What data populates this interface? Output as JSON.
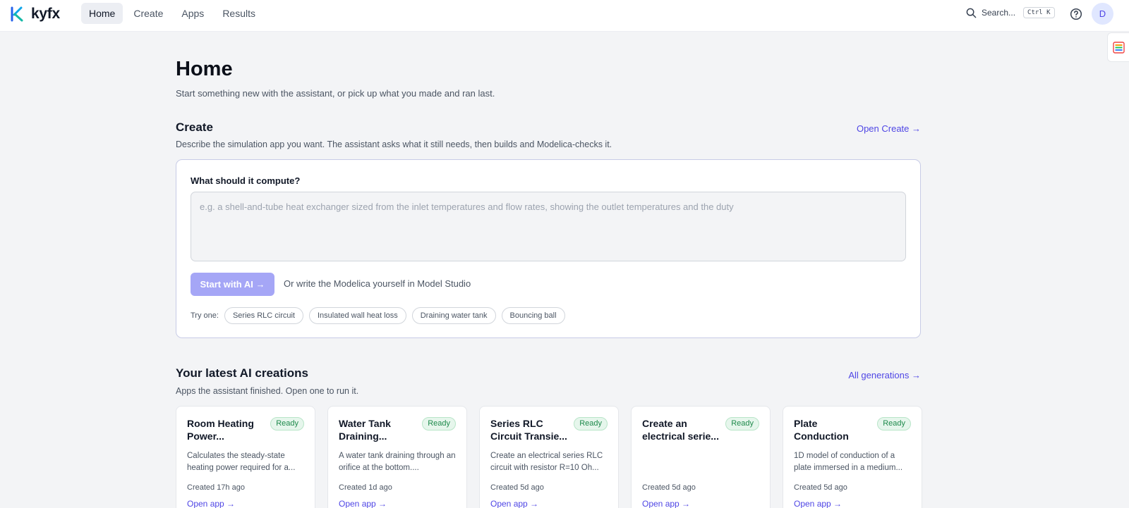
{
  "brand": {
    "name": "kyfx",
    "accent": "#4f46e5"
  },
  "nav": {
    "items": [
      {
        "label": "Home",
        "active": true
      },
      {
        "label": "Create",
        "active": false
      },
      {
        "label": "Apps",
        "active": false
      },
      {
        "label": "Results",
        "active": false
      }
    ]
  },
  "header": {
    "search_label": "Search...",
    "shortcut": "Ctrl K",
    "avatar_initial": "D"
  },
  "page": {
    "title": "Home",
    "subtitle": "Start something new with the assistant, or pick up what you made and ran last."
  },
  "create": {
    "title": "Create",
    "link": "Open Create →",
    "description": "Describe the simulation app you want. The assistant asks what it still needs, then builds and Modelica-checks it.",
    "question": "What should it compute?",
    "placeholder": "e.g. a shell-and-tube heat exchanger sized from the inlet temperatures and flow rates, showing the outlet temperatures and the duty",
    "start_button": "Start with AI →",
    "alt_link": "Or write the Modelica yourself in Model Studio",
    "try_label": "Try one:",
    "examples": [
      "Series RLC circuit",
      "Insulated wall heat loss",
      "Draining water tank",
      "Bouncing ball"
    ]
  },
  "latest": {
    "title": "Your latest AI creations",
    "link": "All generations →",
    "description": "Apps the assistant finished. Open one to run it.",
    "cards": [
      {
        "title": "Room Heating Power...",
        "status": "Ready",
        "description": "Calculates the steady-state heating power required for a...",
        "created": "Created 17h ago",
        "link": "Open app →"
      },
      {
        "title": "Water Tank Draining...",
        "status": "Ready",
        "description": "A water tank draining through an orifice at the bottom....",
        "created": "Created 1d ago",
        "link": "Open app →"
      },
      {
        "title": "Series RLC Circuit Transie...",
        "status": "Ready",
        "description": "Create an electrical series RLC circuit with resistor R=10 Oh...",
        "created": "Created 5d ago",
        "link": "Open app →"
      },
      {
        "title": "Create an electrical serie...",
        "status": "Ready",
        "description": "",
        "created": "Created 5d ago",
        "link": "Open app →"
      },
      {
        "title": "Plate Conduction",
        "status": "Ready",
        "description": "1D model of conduction of a plate immersed in a medium...",
        "created": "Created 5d ago",
        "link": "Open app →"
      }
    ]
  }
}
